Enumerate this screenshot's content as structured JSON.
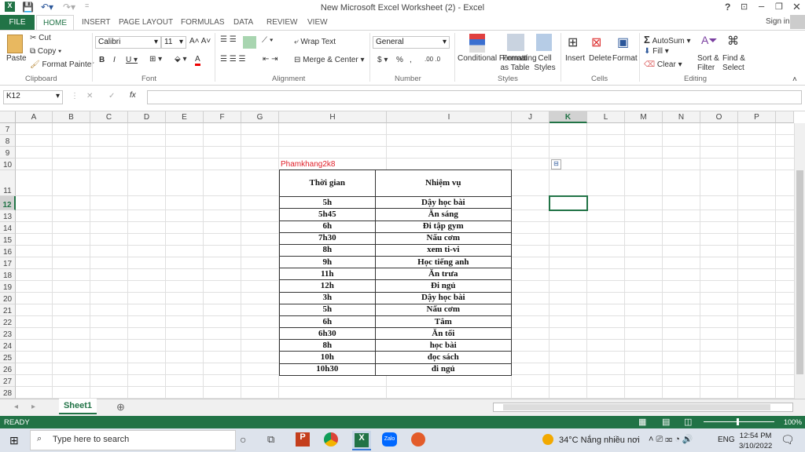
{
  "window": {
    "title": "New Microsoft Excel Worksheet (2) - Excel",
    "help": "?",
    "sign_in": "Sign in"
  },
  "ribbon_tabs": [
    "FILE",
    "HOME",
    "INSERT",
    "PAGE LAYOUT",
    "FORMULAS",
    "DATA",
    "REVIEW",
    "VIEW"
  ],
  "clipboard": {
    "paste": "Paste",
    "cut": "Cut",
    "copy": "Copy",
    "format_painter": "Format Painter",
    "label": "Clipboard"
  },
  "font": {
    "name": "Calibri",
    "size": "11",
    "label": "Font"
  },
  "alignment": {
    "wrap": "Wrap Text",
    "merge": "Merge & Center",
    "label": "Alignment"
  },
  "number": {
    "format": "General",
    "currency": "$",
    "percent": "%",
    "comma": ",",
    "label": "Number"
  },
  "styles": {
    "conditional": "Conditional Formatting",
    "format_table": "Format as Table",
    "cell_styles": "Cell Styles",
    "label": "Styles"
  },
  "cells": {
    "insert": "Insert",
    "delete": "Delete",
    "format": "Format",
    "label": "Cells"
  },
  "editing": {
    "autosum": "AutoSum",
    "fill": "Fill",
    "clear": "Clear",
    "sort": "Sort & Filter",
    "find": "Find & Select",
    "label": "Editing"
  },
  "formula_bar": {
    "name_box": "K12",
    "fx": "fx",
    "value": ""
  },
  "columns": [
    "A",
    "B",
    "C",
    "D",
    "E",
    "F",
    "G",
    "H",
    "I",
    "J",
    "K",
    "L",
    "M",
    "N",
    "O",
    "P"
  ],
  "rows": [
    "7",
    "8",
    "9",
    "10",
    "11",
    "12",
    "13",
    "14",
    "15",
    "16",
    "17",
    "18",
    "19",
    "20",
    "21",
    "22",
    "23",
    "24",
    "25",
    "26",
    "27",
    "28"
  ],
  "sheet": {
    "caption": "Phamkhang2k8",
    "headers": [
      "Thời gian",
      "Nhiệm vụ"
    ],
    "rows": [
      [
        "5h",
        "Dậy học bài"
      ],
      [
        "5h45",
        "Ăn sáng"
      ],
      [
        "6h",
        "Đi tập gym"
      ],
      [
        "7h30",
        "Nấu cơm"
      ],
      [
        "8h",
        "xem ti-vi"
      ],
      [
        "9h",
        "Học tiếng anh"
      ],
      [
        "11h",
        "Ăn trưa"
      ],
      [
        "12h",
        "Đi ngủ"
      ],
      [
        "3h",
        "Dậy học bài"
      ],
      [
        "5h",
        "Nấu cơm"
      ],
      [
        "6h",
        "Tắm"
      ],
      [
        "6h30",
        "Ăn tối"
      ],
      [
        "8h",
        "học bài"
      ],
      [
        "10h",
        "đọc sách"
      ],
      [
        "10h30",
        "đi ngủ"
      ]
    ]
  },
  "sheet_tabs": [
    "Sheet1"
  ],
  "status": {
    "ready": "READY",
    "zoom": "100%"
  },
  "taskbar": {
    "search": "Type here to search",
    "weather": "34°C  Nắng nhiều nơi",
    "lang": "ENG",
    "time": "12:54 PM",
    "date": "3/10/2022"
  },
  "colors": {
    "excel_green": "#217346",
    "caption_red": "#e0202a"
  }
}
